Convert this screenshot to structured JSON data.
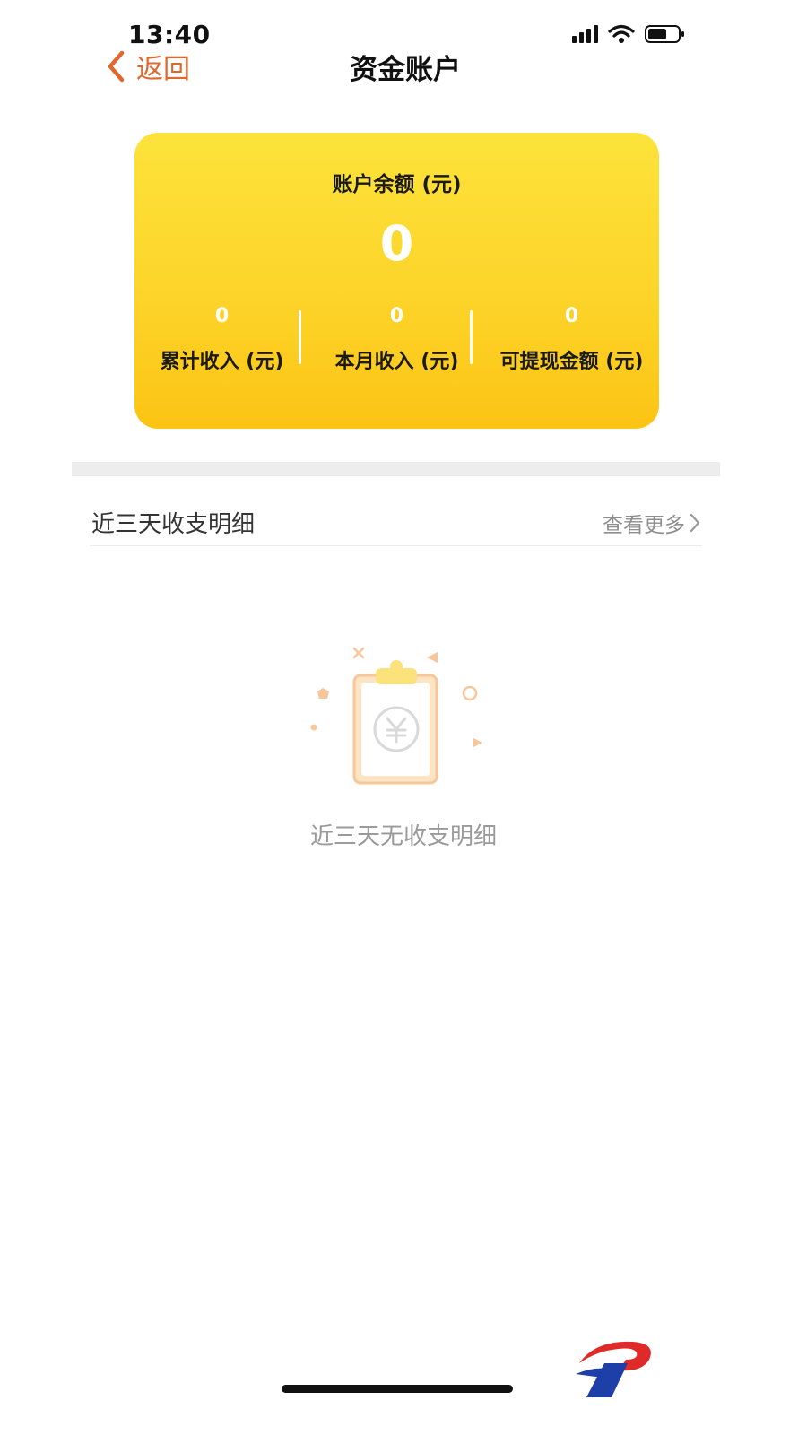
{
  "status_bar": {
    "time": "13:40",
    "icons": [
      "signal-icon",
      "wifi-icon",
      "battery-icon"
    ]
  },
  "nav": {
    "back_label": "返回",
    "title": "资金账户"
  },
  "card": {
    "title": "账户余额 (元)",
    "balance": "0",
    "stats": [
      {
        "value": "0",
        "label": "累计收入 (元)"
      },
      {
        "value": "0",
        "label": "本月收入 (元)"
      },
      {
        "value": "0",
        "label": "可提现金额 (元)"
      }
    ]
  },
  "section": {
    "title": "近三天收支明细",
    "more_label": "查看更多"
  },
  "empty_state": {
    "text": "近三天无收支明细",
    "icon": "empty-clipboard-yuan-icon"
  },
  "colors": {
    "accent": "#e0682e",
    "card_top": "#fde33a",
    "card_bottom": "#fcc414",
    "illustration": "#f7c79b"
  }
}
